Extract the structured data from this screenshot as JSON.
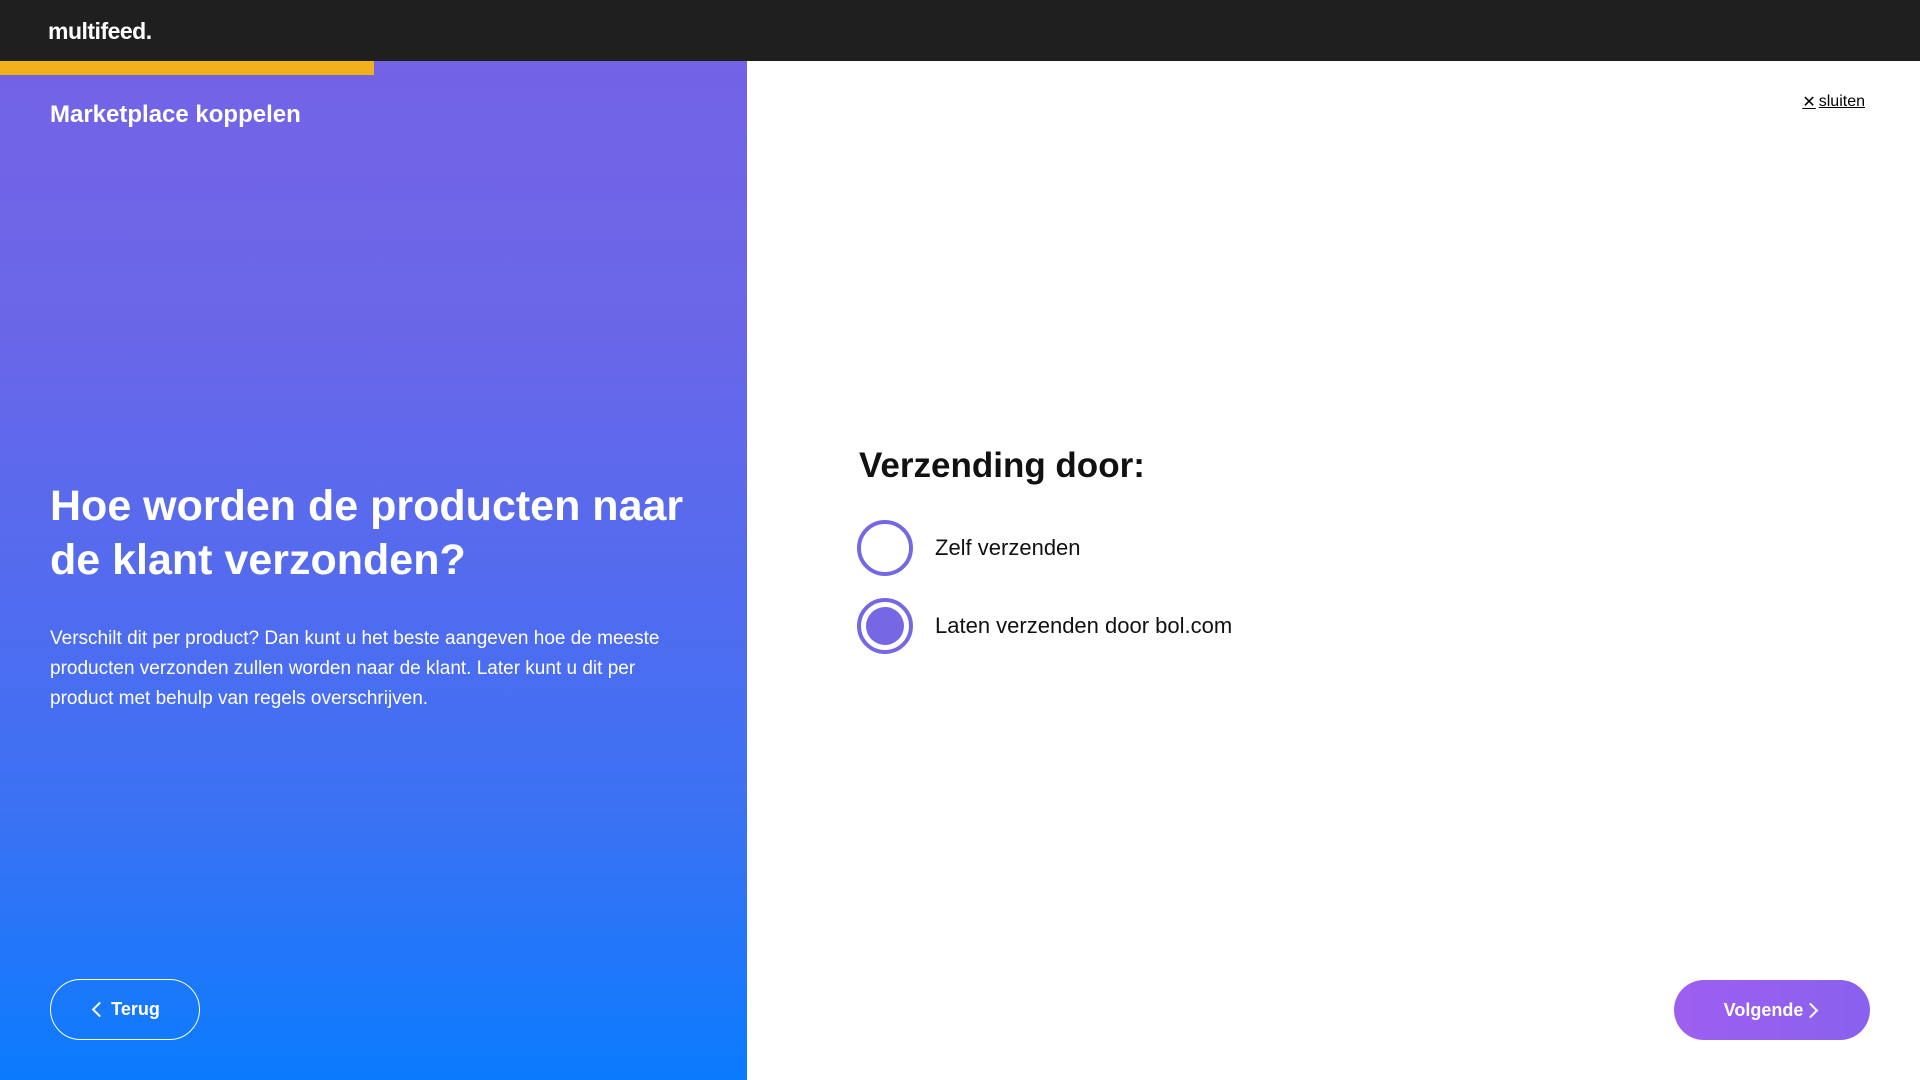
{
  "header": {
    "logo_text": "multifeed."
  },
  "left_panel": {
    "progress_fraction": 0.5,
    "progress_color": "#f2b01a",
    "title": "Marketplace koppelen",
    "question": "Hoe worden de producten naar de klant verzonden?",
    "description": "Verschilt dit per product? Dan kunt u het beste aangeven hoe de meeste producten verzonden zullen worden naar de klant. Later kunt u dit per product met behulp van regels overschrijven.",
    "back_button_label": "Terug"
  },
  "main": {
    "close_label": "sluiten",
    "close_icon": "close-icon",
    "heading": "Verzending door:",
    "options": [
      {
        "label": "Zelf verzenden",
        "selected": false
      },
      {
        "label": "Laten verzenden door bol.com",
        "selected": true
      }
    ],
    "next_button_label": "Volgende",
    "accent_color": "#7668e4"
  }
}
